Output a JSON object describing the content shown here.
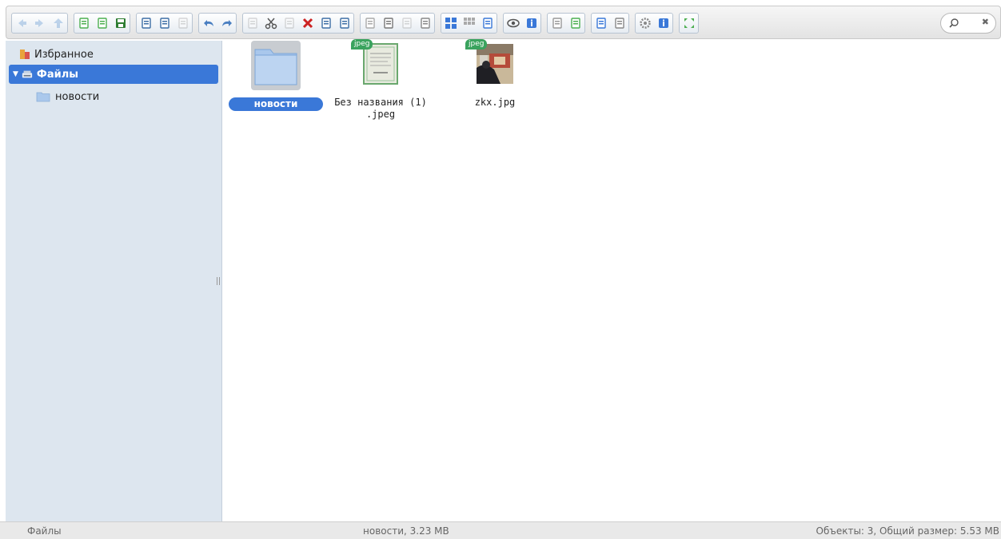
{
  "toolbar": {
    "groups": [
      {
        "buttons": [
          {
            "name": "back-icon",
            "color": "#7aa7d8",
            "disabled": true
          },
          {
            "name": "forward-icon",
            "color": "#7aa7d8",
            "disabled": true
          },
          {
            "name": "up-icon",
            "color": "#7aa7d8",
            "disabled": true
          }
        ]
      },
      {
        "buttons": [
          {
            "name": "reload-icon",
            "color": "#4caf50"
          },
          {
            "name": "new-file-icon",
            "color": "#4caf50"
          },
          {
            "name": "save-icon",
            "color": "#2e7d32"
          }
        ]
      },
      {
        "buttons": [
          {
            "name": "open-icon",
            "color": "#3d6ea5"
          },
          {
            "name": "download-icon",
            "color": "#3d6ea5"
          },
          {
            "name": "select-icon",
            "color": "#aaaaaa",
            "disabled": true
          }
        ]
      },
      {
        "buttons": [
          {
            "name": "undo-icon",
            "color": "#4a7fc1"
          },
          {
            "name": "redo-icon",
            "color": "#4a7fc1"
          }
        ]
      },
      {
        "buttons": [
          {
            "name": "copy-icon",
            "color": "#aaaaaa",
            "disabled": true
          },
          {
            "name": "cut-icon",
            "color": "#555555"
          },
          {
            "name": "paste-icon",
            "color": "#aaaaaa",
            "disabled": true
          },
          {
            "name": "delete-icon",
            "color": "#cc2222"
          },
          {
            "name": "empty-icon",
            "color": "#3d6ea5"
          },
          {
            "name": "duplicate-icon",
            "color": "#3d6ea5"
          }
        ]
      },
      {
        "buttons": [
          {
            "name": "rename-icon",
            "color": "#aaaaaa"
          },
          {
            "name": "edit-icon",
            "color": "#777777"
          },
          {
            "name": "resize-icon",
            "color": "#aaaaaa",
            "disabled": true
          },
          {
            "name": "archive-icon",
            "color": "#888888"
          }
        ]
      },
      {
        "buttons": [
          {
            "name": "view-icons-icon",
            "color": "#3a78d8"
          },
          {
            "name": "view-small-icon",
            "color": "#aaaaaa"
          },
          {
            "name": "view-list-icon",
            "color": "#3a78d8"
          }
        ]
      },
      {
        "buttons": [
          {
            "name": "preview-icon",
            "color": "#555555"
          },
          {
            "name": "info-icon",
            "color": "#3a78d8"
          }
        ]
      },
      {
        "buttons": [
          {
            "name": "extract-icon",
            "color": "#999999"
          },
          {
            "name": "compress-icon",
            "color": "#4caf50"
          }
        ]
      },
      {
        "buttons": [
          {
            "name": "sort-icon",
            "color": "#3a78d8"
          },
          {
            "name": "places-icon",
            "color": "#888888"
          }
        ]
      },
      {
        "buttons": [
          {
            "name": "settings-icon",
            "color": "#888888"
          },
          {
            "name": "help-icon",
            "color": "#3a78d8"
          }
        ]
      },
      {
        "buttons": [
          {
            "name": "fullscreen-icon",
            "color": "#4caf50"
          }
        ]
      }
    ]
  },
  "search": {
    "placeholder": "",
    "value": ""
  },
  "sidebar": {
    "favorites_label": "Избранное",
    "files_label": "Файлы",
    "folder_label": "новости"
  },
  "files": [
    {
      "name": "новости",
      "type": "folder",
      "selected": true
    },
    {
      "name": "Без названия (1) .jpeg",
      "type": "image",
      "badge": "jpeg"
    },
    {
      "name": "zkx.jpg",
      "type": "image",
      "badge": "jpeg"
    }
  ],
  "file_names": {
    "folder": "новости",
    "img1_line1": "Без названия (1)",
    "img1_line2": ".jpeg",
    "img2": "zkx.jpg",
    "badge1": "jpeg",
    "badge2": "jpeg"
  },
  "status": {
    "left": "Файлы",
    "center": "новости, 3.23 MB",
    "right": "Объекты: 3, Общий размер: 5.53 MB"
  },
  "colors": {
    "accent": "#3a78d8",
    "sidebar_bg": "#dde6ef",
    "badge": "#3aa35e"
  }
}
